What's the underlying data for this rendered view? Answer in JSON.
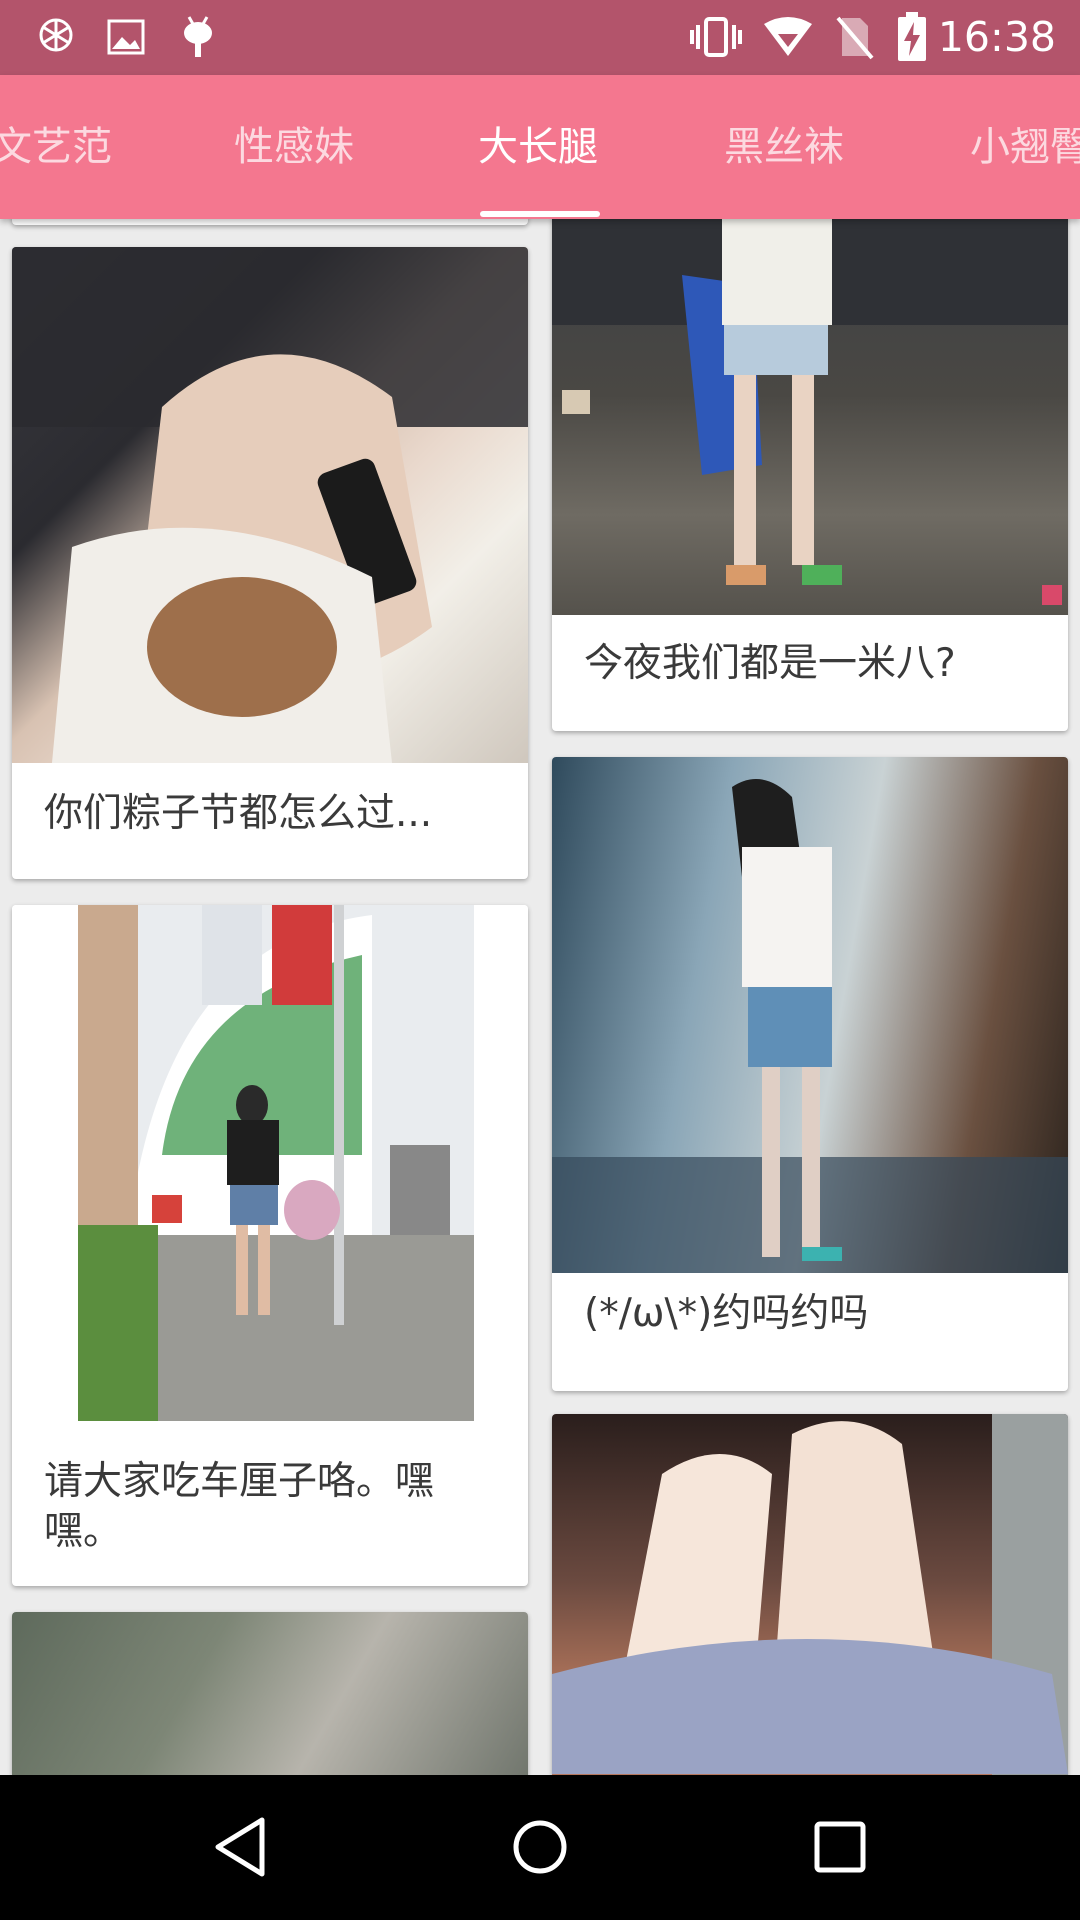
{
  "status_bar": {
    "time": "16:38",
    "icons": [
      "app-logo-icon",
      "image-icon",
      "android-icon",
      "vibrate-icon",
      "wifi-icon",
      "no-sim-icon",
      "battery-charging-icon"
    ]
  },
  "tabs": [
    {
      "label": "文艺范",
      "active": false
    },
    {
      "label": "性感妹",
      "active": false
    },
    {
      "label": "大长腿",
      "active": true
    },
    {
      "label": "黑丝袜",
      "active": false
    },
    {
      "label": "小翘臀",
      "active": false
    }
  ],
  "cards": [
    {
      "caption": ""
    },
    {
      "caption": "你们粽子节都怎么过..."
    },
    {
      "caption": "请大家吃车厘子咯。嘿嘿。"
    },
    {
      "caption": ""
    },
    {
      "caption": "今夜我们都是一米八?"
    },
    {
      "caption": "(*/ω\\*)约吗约吗"
    },
    {
      "caption": ""
    }
  ],
  "navigation": {
    "back": "back-icon",
    "home": "home-icon",
    "recents": "recents-icon"
  },
  "colors": {
    "status_bar": "#b3546b",
    "tab_bar": "#f4778f",
    "background": "#ececec",
    "nav_bar": "#000000"
  }
}
